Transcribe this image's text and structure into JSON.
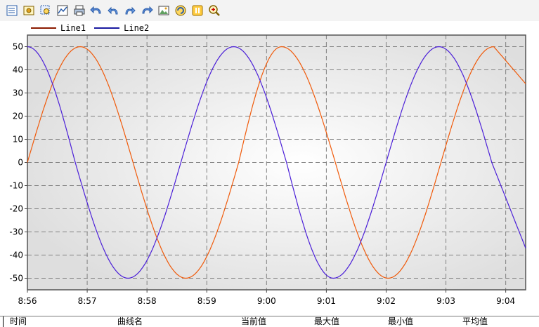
{
  "toolbar": {
    "buttons": [
      {
        "icon": "properties-icon"
      },
      {
        "icon": "settings-icon"
      },
      {
        "icon": "zoom-area-icon"
      },
      {
        "icon": "chart-icon"
      },
      {
        "icon": "print-icon"
      },
      {
        "icon": "undo-all-icon"
      },
      {
        "icon": "undo-icon"
      },
      {
        "icon": "redo-icon"
      },
      {
        "icon": "redo-all-icon"
      },
      {
        "icon": "save-image-icon"
      },
      {
        "icon": "refresh-icon"
      },
      {
        "icon": "pause-icon"
      },
      {
        "icon": "zoom-in-icon"
      }
    ]
  },
  "legend": [
    {
      "label": "Line1",
      "color": "#8b1a00"
    },
    {
      "label": "Line2",
      "color": "#1a1aa0"
    }
  ],
  "grid_header": {
    "columns": [
      "时间",
      "曲线名",
      "当前值",
      "最大值",
      "最小值",
      "平均值"
    ]
  },
  "chart_data": {
    "type": "line",
    "title": "",
    "xlabel": "",
    "ylabel": "",
    "x_ticks": [
      "8:56",
      "8:57",
      "8:58",
      "8:59",
      "9:00",
      "9:01",
      "9:02",
      "9:03",
      "9:04"
    ],
    "x_range": [
      "8:56",
      "9:04.33"
    ],
    "ylim": [
      -55,
      55
    ],
    "y_ticks": [
      -50,
      -40,
      -30,
      -20,
      -10,
      0,
      10,
      20,
      30,
      40,
      50
    ],
    "grid": true,
    "legend_position": "top-left",
    "series": [
      {
        "name": "Line1",
        "color": "#f05a0a",
        "points": [
          {
            "x": "8:56:00",
            "y": 0
          },
          {
            "x": "8:56:53",
            "y": 50
          },
          {
            "x": "8:57:46",
            "y": 0
          },
          {
            "x": "8:58:39",
            "y": -50
          },
          {
            "x": "8:59:32",
            "y": 0
          },
          {
            "x": "9:00:15",
            "y": 50
          },
          {
            "x": "9:01:09",
            "y": 0
          },
          {
            "x": "9:02:02",
            "y": -50
          },
          {
            "x": "9:02:55",
            "y": 0
          },
          {
            "x": "9:03:48",
            "y": 50
          },
          {
            "x": "9:04:20",
            "y": 34
          }
        ]
      },
      {
        "name": "Line2",
        "color": "#4b1fd8",
        "points": [
          {
            "x": "8:56:00",
            "y": 50
          },
          {
            "x": "8:56:48",
            "y": 0
          },
          {
            "x": "8:57:41",
            "y": -50
          },
          {
            "x": "8:58:34",
            "y": 0
          },
          {
            "x": "8:59:27",
            "y": 50
          },
          {
            "x": "9:00:20",
            "y": 0
          },
          {
            "x": "9:01:07",
            "y": -50
          },
          {
            "x": "9:02:00",
            "y": 0
          },
          {
            "x": "9:02:53",
            "y": 50
          },
          {
            "x": "9:03:46",
            "y": 0
          },
          {
            "x": "9:04:20",
            "y": -37
          }
        ]
      }
    ]
  }
}
